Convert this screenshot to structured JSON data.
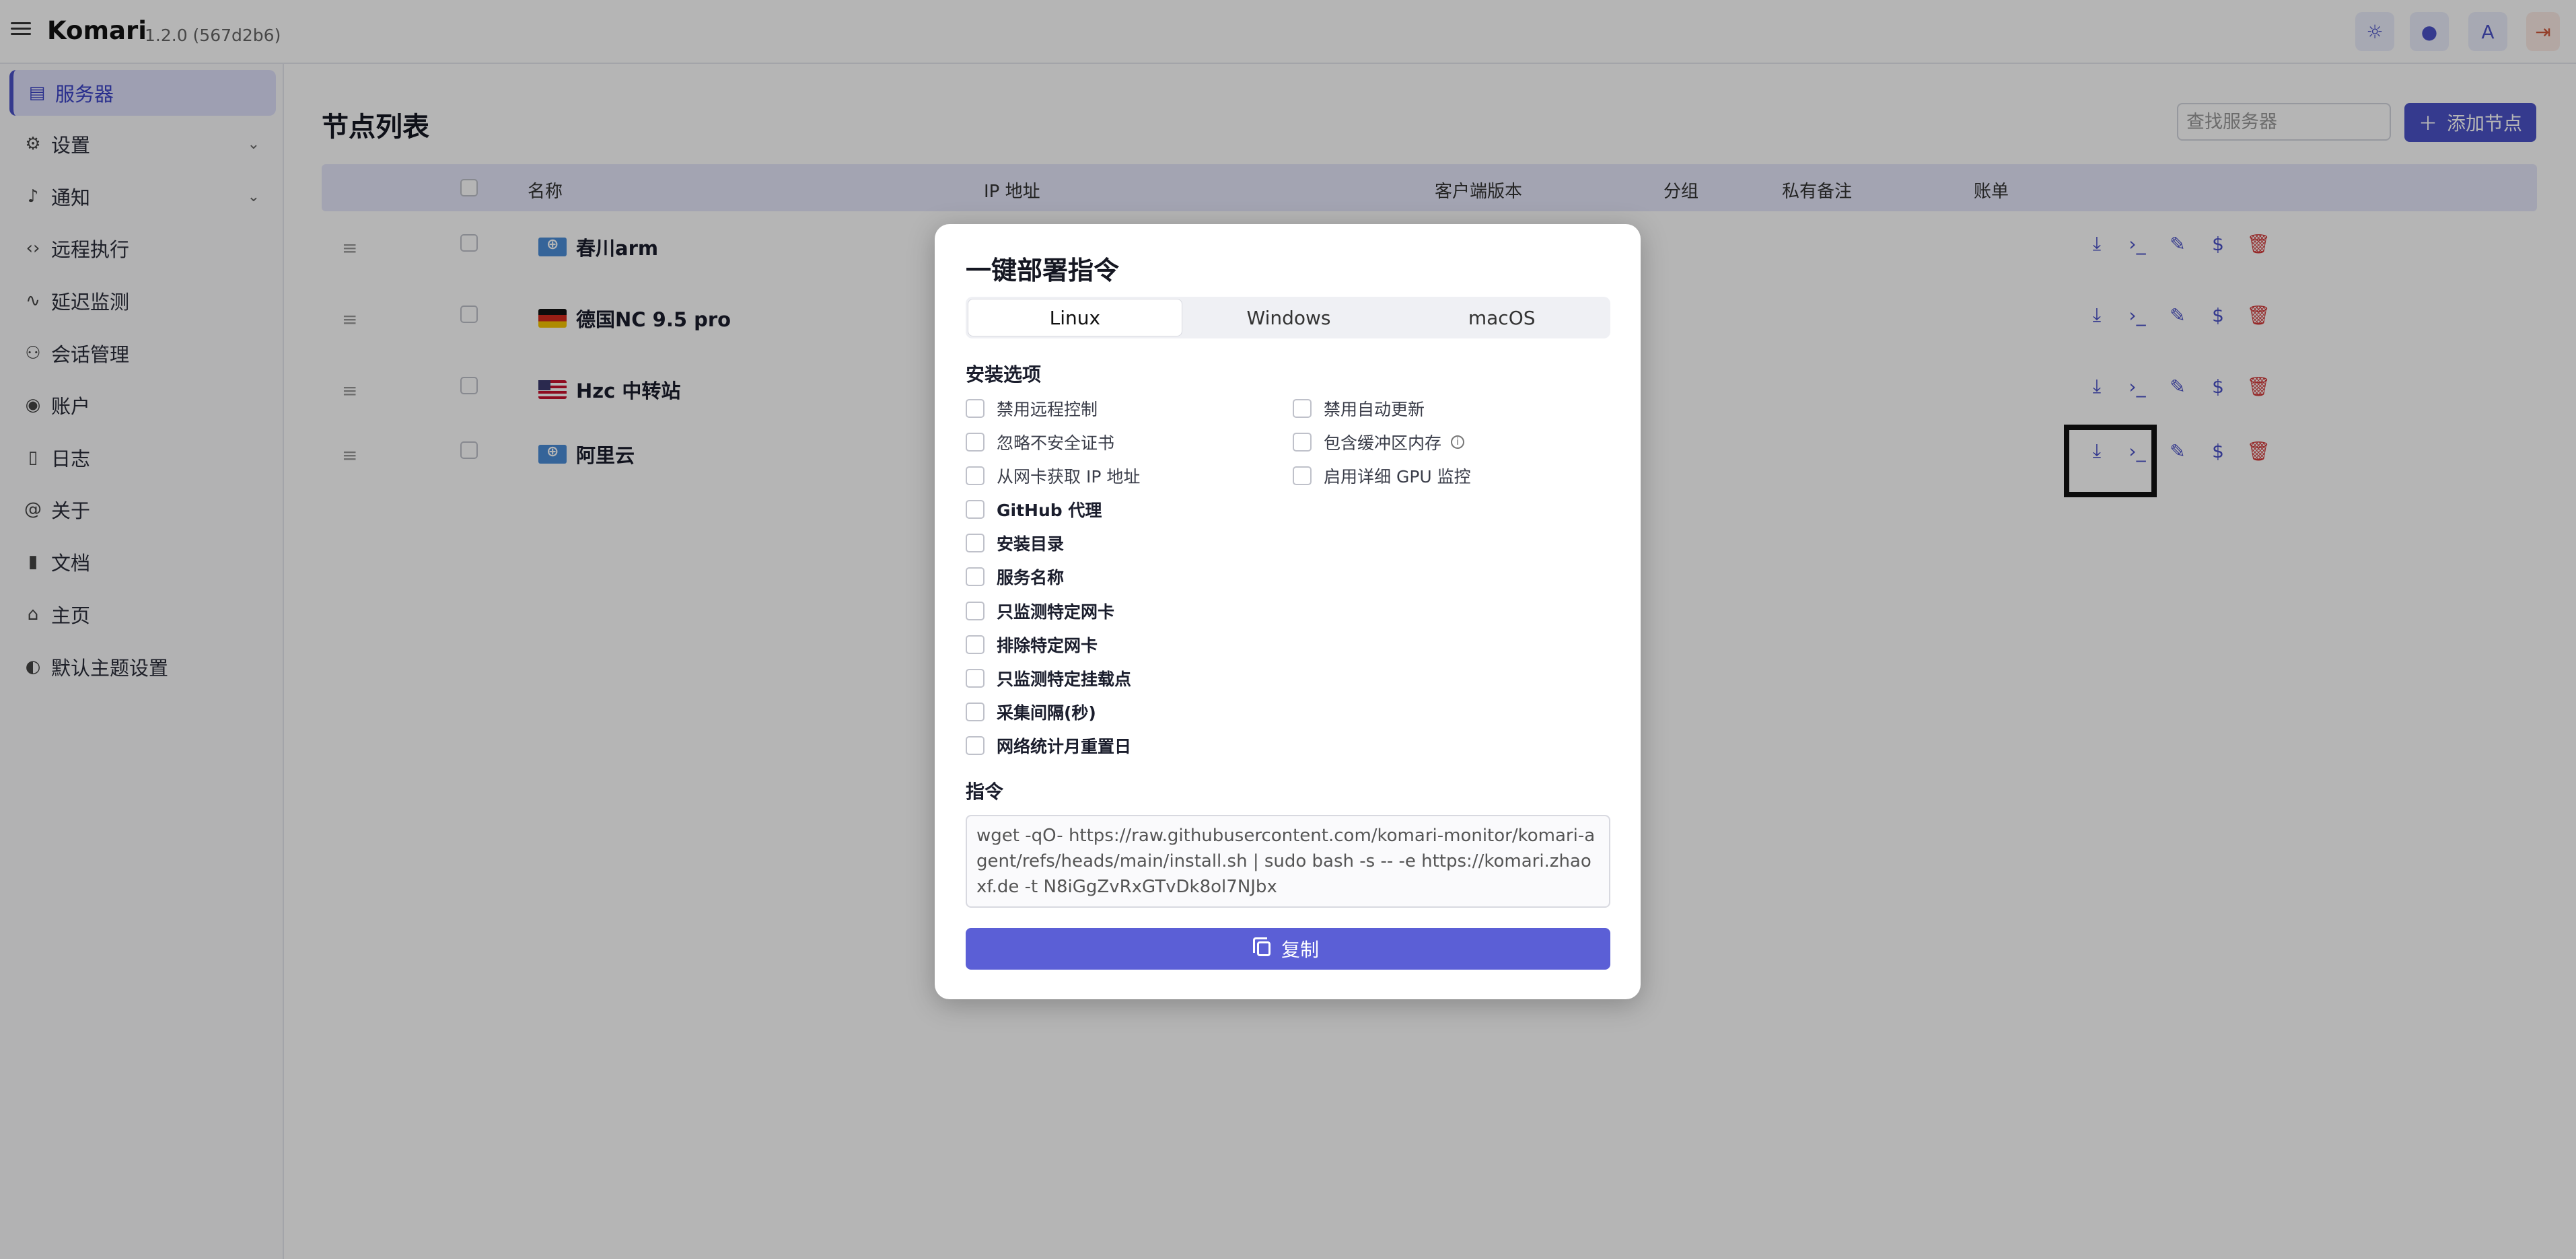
{
  "app": {
    "name": "Komari",
    "version": "1.2.0 (567d2b6)"
  },
  "topbar_icons": [
    "theme-sun-icon",
    "color-drop-icon",
    "translate-icon",
    "logout-icon"
  ],
  "sidebar": {
    "items": [
      {
        "label": "服务器",
        "icon": "server-icon",
        "active": true
      },
      {
        "label": "设置",
        "icon": "settings-icon",
        "expandable": true
      },
      {
        "label": "通知",
        "icon": "bell-icon",
        "expandable": true
      },
      {
        "label": "远程执行",
        "icon": "code-icon"
      },
      {
        "label": "延迟监测",
        "icon": "activity-icon"
      },
      {
        "label": "会话管理",
        "icon": "users-icon"
      },
      {
        "label": "账户",
        "icon": "account-icon"
      },
      {
        "label": "日志",
        "icon": "log-icon"
      },
      {
        "label": "关于",
        "icon": "at-icon"
      },
      {
        "label": "文档",
        "icon": "book-icon"
      },
      {
        "label": "主页",
        "icon": "home-icon"
      },
      {
        "label": "默认主题设置",
        "icon": "palette-icon"
      }
    ]
  },
  "main": {
    "title": "节点列表",
    "search_placeholder": "查找服务器",
    "add_button": "添加节点",
    "columns": [
      "名称",
      "IP 地址",
      "客户端版本",
      "分组",
      "私有备注",
      "账单"
    ],
    "rows": [
      {
        "name": "春川arm",
        "flag": "un"
      },
      {
        "name": "德国NC 9.5 pro",
        "flag": "de"
      },
      {
        "name": "Hzc 中转站",
        "flag": "us"
      },
      {
        "name": "阿里云",
        "flag": "un"
      }
    ],
    "row_actions": [
      "download-icon",
      "terminal-icon",
      "edit-icon",
      "billing-icon",
      "delete-icon"
    ]
  },
  "dialog": {
    "title": "一键部署指令",
    "tabs": [
      "Linux",
      "Windows",
      "macOS"
    ],
    "active_tab": "Linux",
    "options_title": "安装选项",
    "options_left": [
      "禁用远程控制",
      "忽略不安全证书",
      "从网卡获取 IP 地址"
    ],
    "options_right": [
      "禁用自动更新",
      "包含缓冲区内存",
      "启用详细 GPU 监控"
    ],
    "options_bold": [
      "GitHub 代理",
      "安装目录",
      "服务名称",
      "只监测特定网卡",
      "排除特定网卡",
      "只监测特定挂载点",
      "采集间隔(秒)",
      "网络统计月重置日"
    ],
    "command_title": "指令",
    "command": "wget -qO- https://raw.githubusercontent.com/komari-monitor/komari-agent/refs/heads/main/install.sh | sudo bash -s -- -e https://komari.zhaoxf.de -t N8iGgZvRxGTvDk8ol7NJbx",
    "copy_button": "复制"
  }
}
